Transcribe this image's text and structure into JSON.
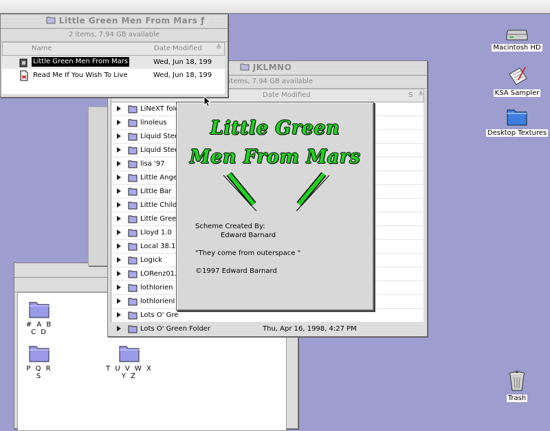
{
  "window1": {
    "title": "Little Green Men From Mars ƒ",
    "info": "2 items, 7.94 GB available",
    "col_name": "Name",
    "col_date": "Date Modified",
    "rows": [
      {
        "name": "Little Green Men From Mars",
        "date": "Wed, Jun 18, 199"
      },
      {
        "name": "Read Me If You Wish To Live",
        "date": "Wed, Jun 18, 199"
      }
    ]
  },
  "window2": {
    "title": "JKLMNO",
    "info": "5 items, 7.94 GB available",
    "col_date": "Date Modified",
    "col_s": "S",
    "rows": [
      {
        "name": "LiNeXT fold",
        "date": ""
      },
      {
        "name": "linoleus",
        "date": ""
      },
      {
        "name": "Liquid Stee",
        "date": ""
      },
      {
        "name": "Liquid Stee",
        "date": ""
      },
      {
        "name": "lisa '97",
        "date": ""
      },
      {
        "name": "Little Ange",
        "date": ""
      },
      {
        "name": "Little Bar",
        "date": ""
      },
      {
        "name": "Little Child",
        "date": ""
      },
      {
        "name": "Little Gree",
        "date": ""
      },
      {
        "name": "Lloyd 1.0",
        "date": ""
      },
      {
        "name": "Local 38.1",
        "date": ""
      },
      {
        "name": "Logick",
        "date": ""
      },
      {
        "name": "LORenz01.",
        "date": ""
      },
      {
        "name": "lothlorien",
        "date": ""
      },
      {
        "name": "lothlorienI",
        "date": ""
      },
      {
        "name": "Lots O' Gre",
        "date": ""
      },
      {
        "name": "Lots O' Green Folder",
        "date": "Thu, Apr 16, 1998, 4:27 PM"
      }
    ]
  },
  "window3": {
    "folders": [
      {
        "label": "# A B C D"
      },
      {
        "label": "P Q R S"
      },
      {
        "label": "T U V W X Y Z"
      }
    ]
  },
  "about": {
    "title_line1": "Little Green",
    "title_line2": "Men From Mars",
    "credit_label": "Scheme Created By:",
    "credit_name": "Edward Barnard",
    "quote": "\"They come from outerspace \"",
    "copyright": "©1997 Edward Barnard"
  },
  "desktop": {
    "icons": [
      {
        "label": "Macintosh HD",
        "icon": "hard-drive-icon"
      },
      {
        "label": "KSA Sampler",
        "icon": "document-icon"
      },
      {
        "label": "Desktop Textures",
        "icon": "folder-icon"
      },
      {
        "label": "Trash",
        "icon": "trash-icon"
      }
    ]
  },
  "colors": {
    "desktop": "#9d9dcf",
    "folder": "#9a9ae8",
    "accent_green": "#22d022"
  }
}
